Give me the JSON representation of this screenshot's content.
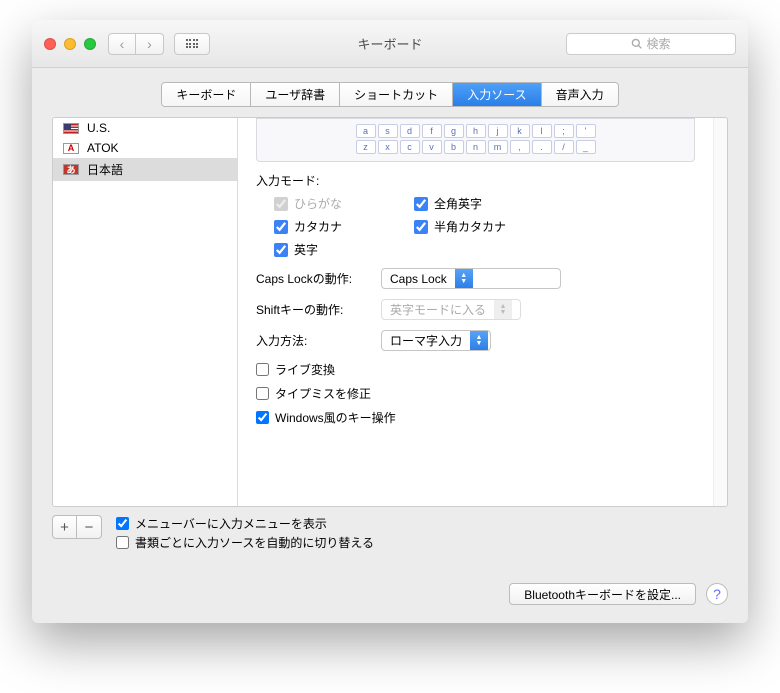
{
  "window": {
    "title": "キーボード"
  },
  "search": {
    "placeholder": "検索"
  },
  "tabs": [
    {
      "label": "キーボード"
    },
    {
      "label": "ユーザ辞書"
    },
    {
      "label": "ショートカット"
    },
    {
      "label": "入力ソース",
      "active": true
    },
    {
      "label": "音声入力"
    }
  ],
  "sources": [
    {
      "label": "U.S.",
      "icon": "us"
    },
    {
      "label": "ATOK",
      "icon": "atok"
    },
    {
      "label": "日本語",
      "icon": "jp",
      "selected": true
    }
  ],
  "keyboard_preview": {
    "row1": [
      "a",
      "s",
      "d",
      "f",
      "g",
      "h",
      "j",
      "k",
      "l",
      ";",
      "'"
    ],
    "row2": [
      "z",
      "x",
      "c",
      "v",
      "b",
      "n",
      "m",
      ",",
      ".",
      "/",
      "_"
    ]
  },
  "detail": {
    "input_mode_label": "入力モード:",
    "modes": {
      "hiragana": {
        "label": "ひらがな",
        "checked": true,
        "disabled": true
      },
      "zenkaku_eiji": {
        "label": "全角英字",
        "checked": true
      },
      "katakana": {
        "label": "カタカナ",
        "checked": true
      },
      "hankaku_katakana": {
        "label": "半角カタカナ",
        "checked": true
      },
      "eiji": {
        "label": "英字",
        "checked": true
      }
    },
    "caps_lock_label": "Caps Lockの動作:",
    "caps_lock_value": "Caps Lock",
    "shift_label": "Shiftキーの動作:",
    "shift_value": "英字モードに入る",
    "input_method_label": "入力方法:",
    "input_method_value": "ローマ字入力",
    "live_conversion": {
      "label": "ライブ変換",
      "checked": false
    },
    "typo_fix": {
      "label": "タイプミスを修正",
      "checked": false
    },
    "windows_keys": {
      "label": "Windows風のキー操作",
      "checked": true
    }
  },
  "bottom": {
    "show_menu": {
      "label": "メニューバーに入力メニューを表示",
      "checked": true
    },
    "auto_switch": {
      "label": "書類ごとに入力ソースを自動的に切り替える",
      "checked": false
    }
  },
  "footer": {
    "bluetooth_button": "Bluetoothキーボードを設定..."
  }
}
